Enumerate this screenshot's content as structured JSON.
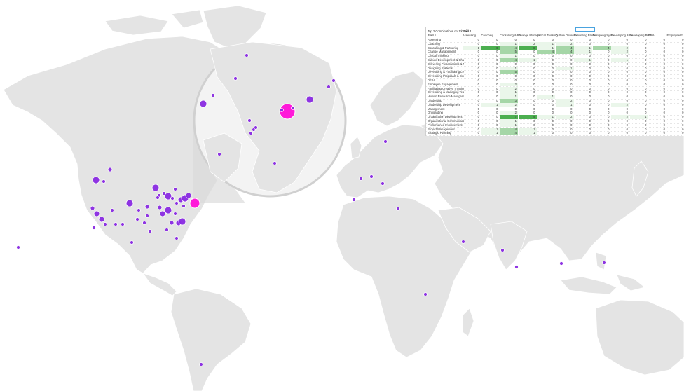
{
  "colors": {
    "land": "#e4e4e4",
    "marker": "#8a2be2",
    "marker_hot": "#ff19d9",
    "heat_low": "#eaf6ea",
    "heat_mid": "#a5d6a7",
    "heat_high": "#4caf50"
  },
  "table": {
    "title": "Top 2 Combinations on Job  Des",
    "column_group": "Skill 2",
    "row_header": "Skill 1",
    "columns": [
      "Assessing",
      "Coaching",
      "Consulting & Pa",
      "Change Manage",
      "Critical Thinking",
      "Culture Develop",
      "Delivering Prese",
      "Designing Syste",
      "Developing & Fa",
      "Developing Prop",
      "DE&I",
      "Employee E"
    ],
    "rows": [
      {
        "label": "Assessing",
        "values": [
          0,
          0,
          0,
          0,
          0,
          0,
          0,
          0,
          0,
          0,
          0,
          0
        ]
      },
      {
        "label": "Coaching",
        "values": [
          0,
          0,
          1,
          2,
          1,
          2,
          0,
          0,
          0,
          0,
          0,
          0
        ]
      },
      {
        "label": "Consulting & Partnering",
        "values": [
          1,
          6,
          4,
          8,
          1,
          4,
          1,
          4,
          2,
          0,
          0,
          0
        ]
      },
      {
        "label": "Change Management",
        "values": [
          0,
          0,
          5,
          0,
          4,
          4,
          1,
          0,
          2,
          0,
          0,
          0
        ]
      },
      {
        "label": "Critical Thinking",
        "values": [
          0,
          0,
          1,
          0,
          0,
          0,
          0,
          0,
          0,
          0,
          0,
          0
        ]
      },
      {
        "label": "Culture Development & Change",
        "values": [
          0,
          0,
          4,
          1,
          0,
          0,
          1,
          0,
          1,
          0,
          0,
          0
        ]
      },
      {
        "label": "Delivering Presentations & Facil",
        "values": [
          0,
          0,
          0,
          0,
          0,
          0,
          0,
          0,
          0,
          0,
          0,
          0
        ]
      },
      {
        "label": "Designing Systems",
        "values": [
          0,
          0,
          1,
          0,
          0,
          1,
          0,
          0,
          0,
          0,
          0,
          0
        ]
      },
      {
        "label": "Developing & Facilitating Learni",
        "values": [
          0,
          0,
          5,
          0,
          0,
          0,
          0,
          0,
          0,
          0,
          0,
          0
        ]
      },
      {
        "label": "Developing Proposals & Contrac",
        "values": [
          0,
          0,
          0,
          0,
          0,
          0,
          0,
          0,
          0,
          0,
          0,
          0
        ]
      },
      {
        "label": "DE&I",
        "values": [
          0,
          0,
          0,
          0,
          0,
          0,
          0,
          0,
          0,
          0,
          0,
          0
        ]
      },
      {
        "label": "Employee Engagement",
        "values": [
          0,
          0,
          2,
          0,
          0,
          0,
          0,
          0,
          0,
          0,
          0,
          0
        ]
      },
      {
        "label": "Facilitating Creative Thinking/In",
        "values": [
          0,
          0,
          2,
          0,
          0,
          0,
          0,
          0,
          0,
          0,
          0,
          0
        ]
      },
      {
        "label": "Developing & Managing Teams",
        "values": [
          0,
          0,
          1,
          0,
          0,
          0,
          0,
          0,
          0,
          0,
          0,
          0
        ]
      },
      {
        "label": "Human Resource Management",
        "values": [
          0,
          0,
          1,
          0,
          1,
          0,
          0,
          0,
          0,
          0,
          0,
          0
        ]
      },
      {
        "label": "Leadership",
        "values": [
          0,
          0,
          3,
          0,
          0,
          2,
          0,
          0,
          0,
          0,
          0,
          0
        ]
      },
      {
        "label": "Leadership Development",
        "values": [
          0,
          1,
          2,
          0,
          0,
          1,
          0,
          0,
          2,
          0,
          0,
          0
        ]
      },
      {
        "label": "Management",
        "values": [
          0,
          0,
          0,
          0,
          0,
          0,
          0,
          0,
          0,
          0,
          0,
          0
        ]
      },
      {
        "label": "Onboarding",
        "values": [
          0,
          0,
          2,
          0,
          0,
          0,
          0,
          0,
          0,
          0,
          0,
          0
        ]
      },
      {
        "label": "Organization Development",
        "values": [
          0,
          0,
          7,
          9,
          1,
          2,
          0,
          0,
          2,
          1,
          0,
          0
        ]
      },
      {
        "label": "Organizational Communication",
        "values": [
          0,
          0,
          1,
          0,
          0,
          0,
          0,
          0,
          0,
          0,
          0,
          0
        ]
      },
      {
        "label": "Performance Improvement",
        "values": [
          0,
          0,
          1,
          0,
          0,
          0,
          0,
          0,
          0,
          0,
          0,
          0
        ]
      },
      {
        "label": "Project Management",
        "values": [
          0,
          1,
          4,
          1,
          0,
          0,
          0,
          0,
          0,
          0,
          0,
          0
        ]
      },
      {
        "label": "Strategic Planning",
        "values": [
          0,
          1,
          4,
          1,
          0,
          0,
          0,
          0,
          0,
          0,
          0,
          0
        ]
      }
    ]
  }
}
